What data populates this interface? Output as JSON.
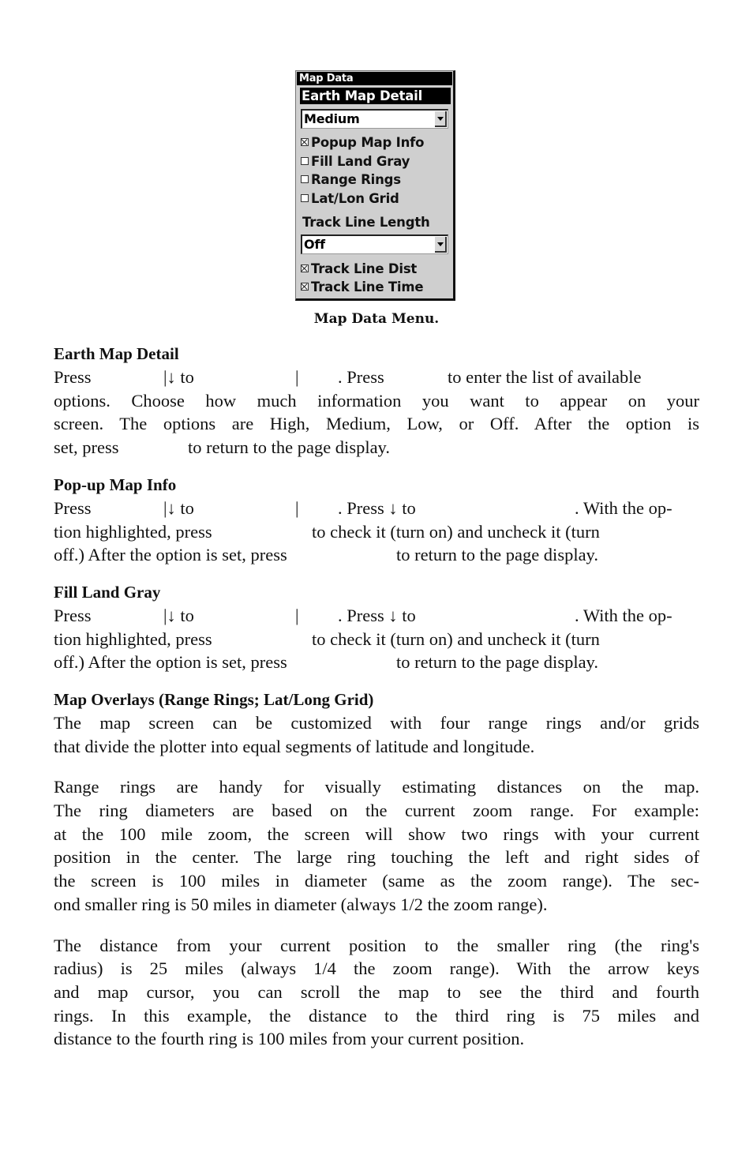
{
  "menu": {
    "title": "Map Data",
    "selected_item": "Earth Map Detail",
    "earth_map_detail_value": "Medium",
    "checkboxes_top": [
      {
        "label": "Popup Map Info",
        "checked": true
      },
      {
        "label": "Fill Land Gray",
        "checked": false
      },
      {
        "label": "Range Rings",
        "checked": false
      },
      {
        "label": "Lat/Lon Grid",
        "checked": false
      }
    ],
    "track_line_length_label": "Track Line Length",
    "track_line_length_value": "Off",
    "checkboxes_bottom": [
      {
        "label": "Track Line Dist",
        "checked": true
      },
      {
        "label": "Track Line Time",
        "checked": true
      }
    ],
    "icons": {
      "dropdown_arrow": "chevron-down-icon",
      "checkbox": "checkbox-icon"
    }
  },
  "caption": "Map Data Menu.",
  "sections": {
    "earth": {
      "heading": "Earth Map Detail",
      "line1": {
        "a": "Press",
        "b": "|↓ to",
        "c": "|",
        "d": ". Press",
        "e": "to enter the list of available"
      },
      "line2": "options. Choose how much information you want to appear on your",
      "line3": "screen. The options are High, Medium, Low, or Off. After the option is",
      "line4": {
        "a": "set, press",
        "b": "to return to the page display."
      }
    },
    "popup": {
      "heading": "Pop-up Map Info",
      "line1": {
        "a": "Press",
        "b": "|↓ to",
        "c": "|",
        "d": ". Press ↓ to",
        "e": ". With the op-"
      },
      "line2": {
        "a": "tion highlighted, press",
        "b": "to check it (turn on) and uncheck it (turn"
      },
      "line3": {
        "a": "off.) After the option is set, press",
        "b": "to return to the page display."
      }
    },
    "fill": {
      "heading": "Fill Land Gray",
      "line1": {
        "a": "Press",
        "b": "|↓ to",
        "c": "|",
        "d": ". Press ↓ to",
        "e": ". With the op-"
      },
      "line2": {
        "a": "tion highlighted, press",
        "b": "to check it (turn on) and uncheck it (turn"
      },
      "line3": {
        "a": "off.) After the option is set, press",
        "b": "to return to the page display."
      }
    },
    "overlays": {
      "heading": "Map Overlays (Range Rings; Lat/Long Grid)",
      "p1": [
        "The map screen can be customized with four range rings and/or grids",
        "that divide the plotter into equal segments of latitude and longitude."
      ],
      "p2": [
        "Range rings are handy for visually estimating distances on the map.",
        "The ring diameters are based on the current zoom range. For example:",
        "at the 100 mile zoom, the screen will show two rings with your current",
        "position in the center. The large ring touching the left and right sides of",
        "the screen is 100 miles in diameter (same as the zoom range). The sec-",
        "ond smaller ring is 50 miles in diameter (always 1/2 the zoom range)."
      ],
      "p3": [
        "The distance from your current position to the smaller ring (the ring's",
        "radius) is 25 miles (always 1/4 the zoom range). With the arrow keys",
        "and map cursor, you can scroll the map to see the third and fourth",
        "rings. In this example, the distance to the third ring is 75 miles and",
        "distance to the fourth ring is 100 miles from your current position."
      ]
    }
  }
}
